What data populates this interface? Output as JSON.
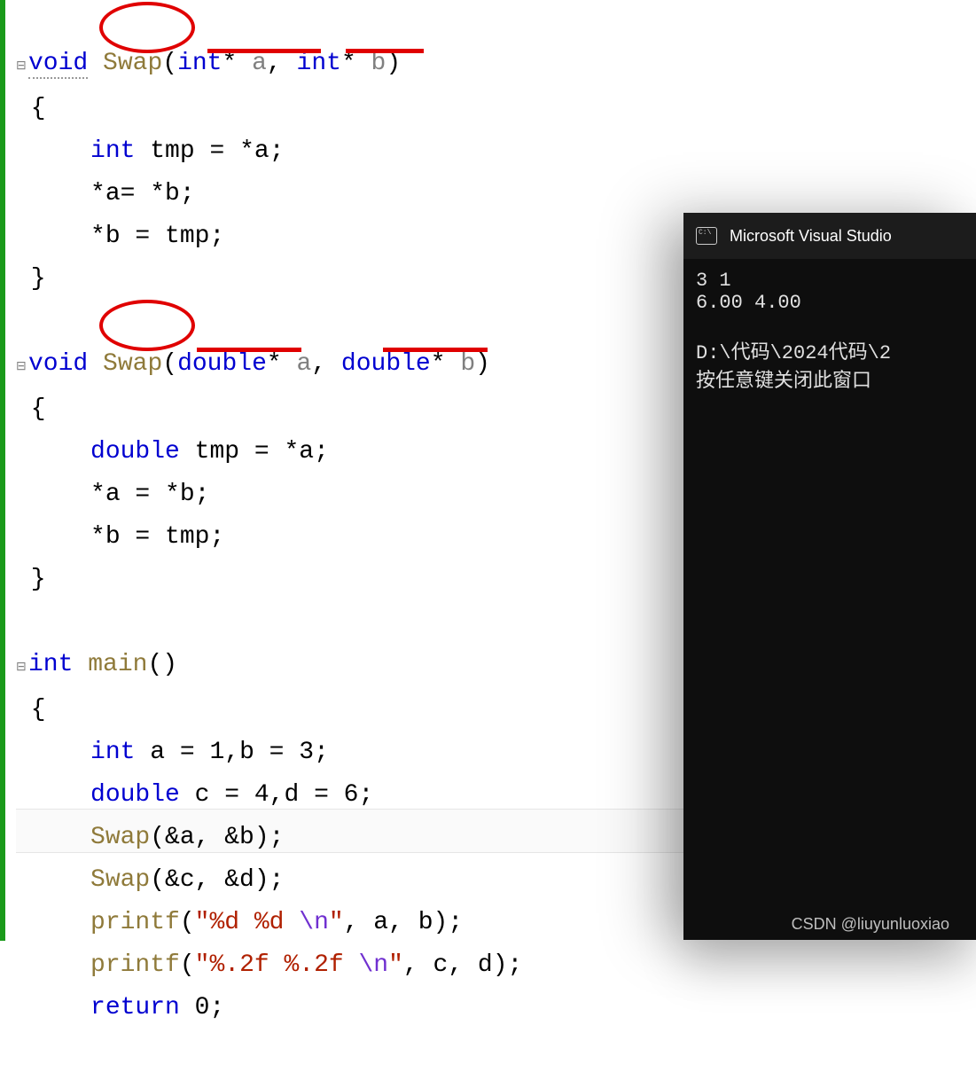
{
  "editor": {
    "swap1": {
      "ret": "void",
      "name": "Swap",
      "t1": "int",
      "p1": "a",
      "t2": "int",
      "p2": "b",
      "body1_t": "int",
      "body1_v": "tmp",
      "body1_rhs": "*a;",
      "body2": "*a= *b;",
      "body3": "*b = tmp;"
    },
    "swap2": {
      "ret": "void",
      "name": "Swap",
      "t1": "double",
      "p1": "a",
      "t2": "double",
      "p2": "b",
      "body1_t": "double",
      "body1_v": "tmp",
      "body1_rhs": "*a;",
      "body2": "*a = *b;",
      "body3": "*b = tmp;"
    },
    "main": {
      "ret": "int",
      "name": "main",
      "l1_t": "int",
      "l1": "a = 1,b = 3;",
      "l2_t": "double",
      "l2": "c = 4,d = 6;",
      "l3_fn": "Swap",
      "l3_args": "(&a, &b);",
      "l4_fn": "Swap",
      "l4_args": "(&c, &d);",
      "l5_fn": "printf",
      "l5_str": "\"%d %d ",
      "l5_esc": "\\n",
      "l5_strend": "\"",
      "l5_rest": ", a, b);",
      "l6_fn": "printf",
      "l6_str": "\"%.2f %.2f ",
      "l6_esc": "\\n",
      "l6_strend": "\"",
      "l6_rest": ", c, d);",
      "l7_kw": "return",
      "l7_rest": " 0;"
    }
  },
  "console": {
    "title": "Microsoft Visual Studio",
    "line1": "3 1",
    "line2": "6.00 4.00",
    "line3": "",
    "line4": "D:\\代码\\2024代码\\2",
    "line5": "按任意键关闭此窗口"
  },
  "watermark": "CSDN @liuyunluoxiao"
}
